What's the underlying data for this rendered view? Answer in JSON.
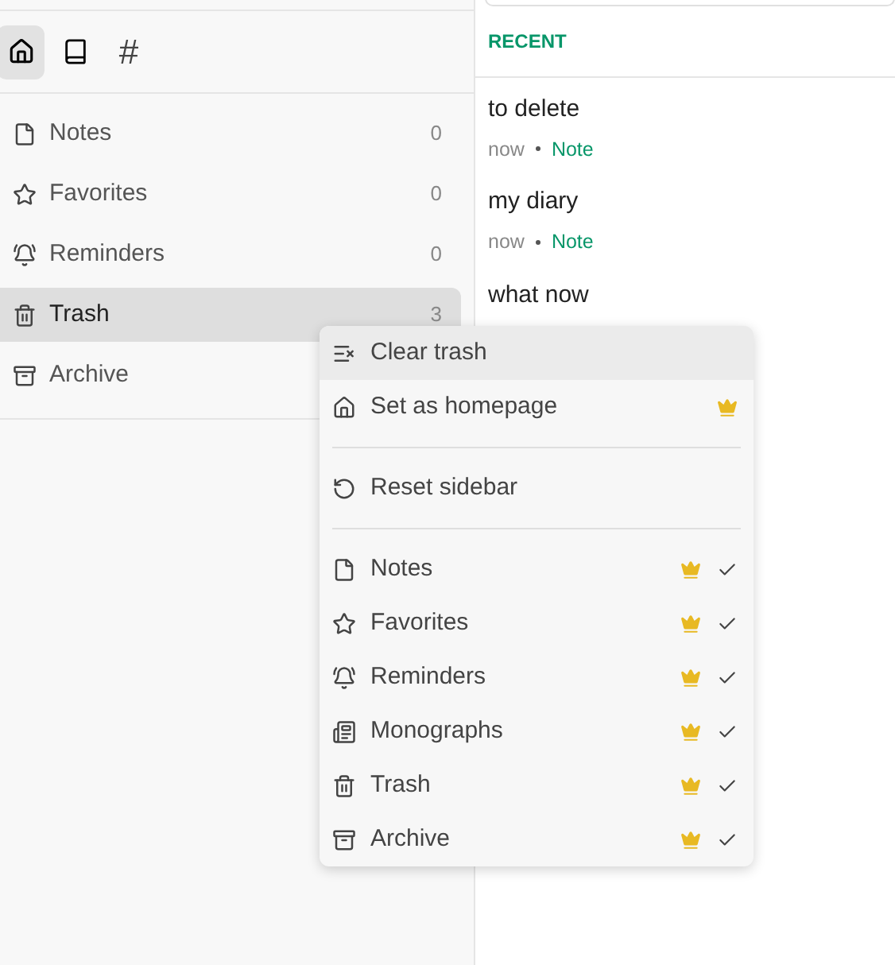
{
  "nav_tabs": [
    {
      "selected": true
    },
    {
      "selected": false
    },
    {
      "selected": false,
      "label": "#"
    }
  ],
  "sidebar": {
    "items": [
      {
        "label": "Notes",
        "count": "0",
        "selected": false
      },
      {
        "label": "Favorites",
        "count": "0",
        "selected": false
      },
      {
        "label": "Reminders",
        "count": "0",
        "selected": false
      },
      {
        "label": "Trash",
        "count": "3",
        "selected": true
      },
      {
        "label": "Archive",
        "selected": false
      }
    ]
  },
  "recent": {
    "heading": "RECENT",
    "notes": [
      {
        "title": "to delete",
        "time": "now",
        "type": "Note"
      },
      {
        "title": "my diary",
        "time": "now",
        "type": "Note"
      },
      {
        "title": "what now"
      }
    ]
  },
  "context_menu": {
    "groups": [
      [
        {
          "label": "Clear trash",
          "highlighted": true,
          "pro": false
        },
        {
          "label": "Set as homepage",
          "highlighted": false,
          "pro": true
        }
      ],
      [
        {
          "label": "Reset sidebar",
          "highlighted": false,
          "pro": false
        }
      ],
      [
        {
          "label": "Notes",
          "highlighted": false,
          "pro": true,
          "checked": true
        },
        {
          "label": "Favorites",
          "highlighted": false,
          "pro": true,
          "checked": true
        },
        {
          "label": "Reminders",
          "highlighted": false,
          "pro": true,
          "checked": true
        },
        {
          "label": "Monographs",
          "highlighted": false,
          "pro": true,
          "checked": true
        },
        {
          "label": "Trash",
          "highlighted": false,
          "pro": true,
          "checked": true
        },
        {
          "label": "Archive",
          "highlighted": false,
          "pro": true,
          "checked": true
        }
      ]
    ]
  }
}
